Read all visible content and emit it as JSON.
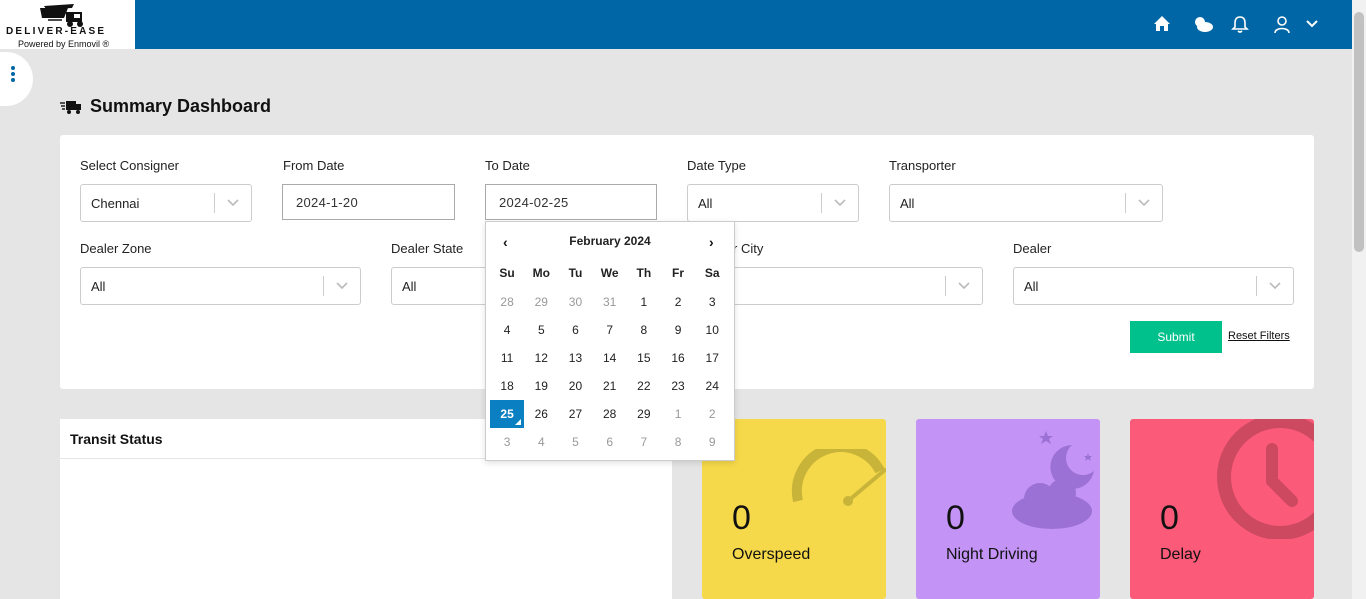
{
  "header": {
    "brand": "DELIVER-EASE",
    "powered_by": "Powered by Enmovil ®",
    "icons": [
      "home-icon",
      "weather-icon",
      "bell-icon",
      "user-icon",
      "chevron-down-icon"
    ]
  },
  "page": {
    "title": "Summary Dashboard"
  },
  "filters": {
    "consigner": {
      "label": "Select Consigner",
      "value": "Chennai"
    },
    "from_date": {
      "label": "From Date",
      "value": "2024-1-20"
    },
    "to_date": {
      "label": "To Date",
      "value": "2024-02-25"
    },
    "date_type": {
      "label": "Date Type",
      "value": "All"
    },
    "transporter": {
      "label": "Transporter",
      "value": "All"
    },
    "dealer_zone": {
      "label": "Dealer Zone",
      "value": "All"
    },
    "dealer_state": {
      "label": "Dealer State",
      "value": "All"
    },
    "dealer_city": {
      "label": "r City",
      "value": ""
    },
    "dealer": {
      "label": "Dealer",
      "value": "All"
    },
    "submit_label": "Submit",
    "reset_label": "Reset Filters"
  },
  "calendar": {
    "month_label": "February 2024",
    "prev": "‹",
    "next": "›",
    "dows": [
      "Su",
      "Mo",
      "Tu",
      "We",
      "Th",
      "Fr",
      "Sa"
    ],
    "days": [
      {
        "d": "28",
        "other": true
      },
      {
        "d": "29",
        "other": true
      },
      {
        "d": "30",
        "other": true
      },
      {
        "d": "31",
        "other": true
      },
      {
        "d": "1"
      },
      {
        "d": "2"
      },
      {
        "d": "3"
      },
      {
        "d": "4"
      },
      {
        "d": "5"
      },
      {
        "d": "6"
      },
      {
        "d": "7"
      },
      {
        "d": "8"
      },
      {
        "d": "9"
      },
      {
        "d": "10"
      },
      {
        "d": "11"
      },
      {
        "d": "12"
      },
      {
        "d": "13"
      },
      {
        "d": "14"
      },
      {
        "d": "15"
      },
      {
        "d": "16"
      },
      {
        "d": "17"
      },
      {
        "d": "18"
      },
      {
        "d": "19"
      },
      {
        "d": "20"
      },
      {
        "d": "21"
      },
      {
        "d": "22"
      },
      {
        "d": "23"
      },
      {
        "d": "24"
      },
      {
        "d": "25",
        "selected": true
      },
      {
        "d": "26"
      },
      {
        "d": "27"
      },
      {
        "d": "28"
      },
      {
        "d": "29"
      },
      {
        "d": "1",
        "other": true
      },
      {
        "d": "2",
        "other": true
      },
      {
        "d": "3",
        "other": true
      },
      {
        "d": "4",
        "other": true
      },
      {
        "d": "5",
        "other": true
      },
      {
        "d": "6",
        "other": true
      },
      {
        "d": "7",
        "other": true
      },
      {
        "d": "8",
        "other": true
      },
      {
        "d": "9",
        "other": true
      }
    ]
  },
  "transit": {
    "title": "Transit Status"
  },
  "stats": [
    {
      "value": "0",
      "label": "Overspeed",
      "color": "#f5d94a",
      "icon": "speedometer-icon"
    },
    {
      "value": "0",
      "label": "Night Driving",
      "color": "#c393f5",
      "icon": "moon-cloud-icon"
    },
    {
      "value": "0",
      "label": "Delay",
      "color": "#fb5a78",
      "icon": "clock-icon"
    }
  ],
  "colors": {
    "topbar": "#0066a5",
    "submit": "#00c08b",
    "selected_day": "#0a7fc2"
  }
}
